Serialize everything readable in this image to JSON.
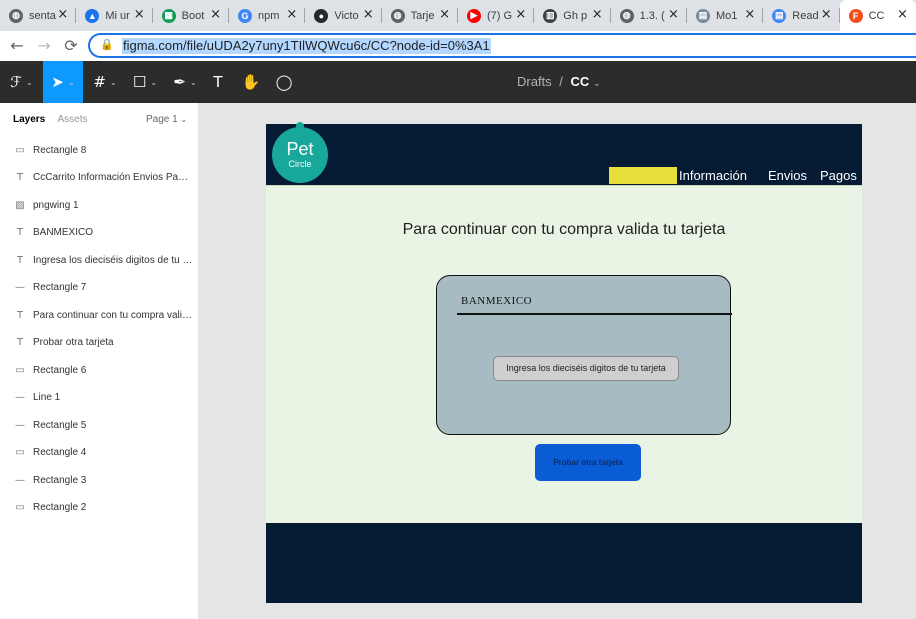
{
  "browser": {
    "tabs": [
      {
        "title": "senta",
        "icon": "globe-icon",
        "color": "#5f6368"
      },
      {
        "title": "Mi ur",
        "icon": "drive-icon",
        "color": "#1a73e8"
      },
      {
        "title": "Boot",
        "icon": "sheets-icon",
        "color": "#0f9d58"
      },
      {
        "title": "npm",
        "icon": "google-icon",
        "color": "#4285f4"
      },
      {
        "title": "Victo",
        "icon": "github-icon",
        "color": "#24292e"
      },
      {
        "title": "Tarje",
        "icon": "globe-icon",
        "color": "#5f6368"
      },
      {
        "title": "(7) G",
        "icon": "youtube-icon",
        "color": "#ff0000"
      },
      {
        "title": "Gh p",
        "icon": "book-icon",
        "color": "#3c4043"
      },
      {
        "title": "1.3. (",
        "icon": "globe-icon",
        "color": "#5f6368"
      },
      {
        "title": "Mo1",
        "icon": "doc-icon",
        "color": "#7a8a9a"
      },
      {
        "title": "Read",
        "icon": "docs-icon",
        "color": "#4285f4"
      },
      {
        "title": "CC",
        "icon": "figma-icon",
        "color": "#f24e1e"
      }
    ],
    "url": "figma.com/file/uUDA2y7uny1TIlWQWcu6c/CC?node-id=0%3A1"
  },
  "figma": {
    "breadcrumb_drafts": "Drafts",
    "breadcrumb_sep": "/",
    "file_name": "CC",
    "panel_tabs": {
      "layers": "Layers",
      "assets": "Assets"
    },
    "page_selector": "Page 1",
    "layers": [
      {
        "name": "Rectangle 8",
        "icon": "rectangle-icon"
      },
      {
        "name": "CcCarrito Información Envios Pagos",
        "icon": "text-icon"
      },
      {
        "name": "pngwing 1",
        "icon": "image-icon"
      },
      {
        "name": "BANMEXICO",
        "icon": "text-icon"
      },
      {
        "name": "Ingresa los dieciséis digitos de tu tarjeta",
        "icon": "text-icon"
      },
      {
        "name": "Rectangle 7",
        "icon": "line-icon"
      },
      {
        "name": "Para continuar con tu compra valida tu tarjeta",
        "icon": "text-icon"
      },
      {
        "name": "Probar otra tarjeta",
        "icon": "text-icon"
      },
      {
        "name": "Rectangle 6",
        "icon": "rectangle-icon"
      },
      {
        "name": "Line 1",
        "icon": "line-icon"
      },
      {
        "name": "Rectangle 5",
        "icon": "line-icon"
      },
      {
        "name": "Rectangle 4",
        "icon": "rectangle-icon"
      },
      {
        "name": "Rectangle 3",
        "icon": "line-icon"
      },
      {
        "name": "Rectangle 2",
        "icon": "rectangle-icon"
      }
    ]
  },
  "design": {
    "logo_main": "Pet",
    "logo_sub": "Circle",
    "nav": [
      "Información",
      "Envios",
      "Pagos"
    ],
    "heading": "Para continuar con tu compra valida tu tarjeta",
    "bank_name": "BANMEXICO",
    "card_input_text": "Ingresa los dieciséis digitos de tu tarjeta",
    "cta_label": "Probar otra tarjeta",
    "colors": {
      "header": "#051b34",
      "body": "#eaf4e4",
      "card": "#a6bcc2",
      "cta": "#0a5bd6",
      "logo": "#17a89b",
      "highlight": "#e8e03a"
    }
  }
}
